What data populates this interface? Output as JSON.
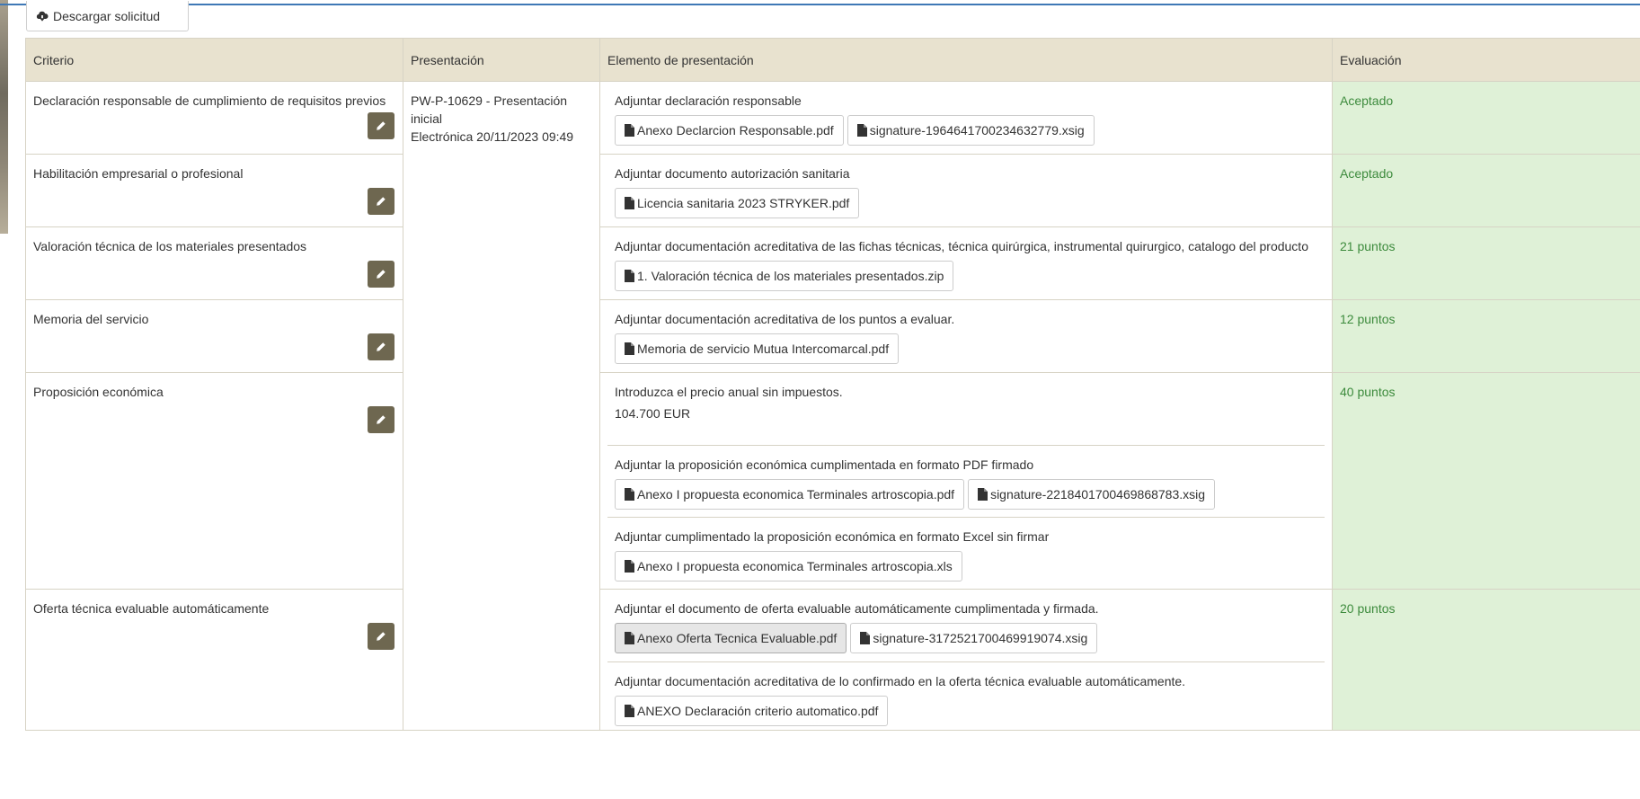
{
  "toolbar": {
    "download_label": "Descargar solicitud"
  },
  "table": {
    "headers": {
      "criterio": "Criterio",
      "presentacion": "Presentación",
      "elemento": "Elemento de presentación",
      "evaluacion": "Evaluación"
    },
    "presentacion": {
      "line1": "PW-P-10629 - Presentación inicial",
      "line2": "Electrónica 20/11/2023 09:49"
    },
    "rows": [
      {
        "criterio": "Declaración responsable de cumplimiento de requisitos previos",
        "evaluacion": "Aceptado",
        "elementos": [
          {
            "label": "Adjuntar declaración responsable",
            "files": [
              "Anexo Declarcion Responsable.pdf",
              "signature-1964641700234632779.xsig"
            ]
          }
        ]
      },
      {
        "criterio": "Habilitación empresarial o profesional",
        "evaluacion": "Aceptado",
        "elementos": [
          {
            "label": "Adjuntar documento autorización sanitaria",
            "files": [
              "Licencia sanitaria 2023 STRYKER.pdf"
            ]
          }
        ]
      },
      {
        "criterio": "Valoración técnica de los materiales presentados",
        "evaluacion": "21 puntos",
        "elementos": [
          {
            "label": "Adjuntar documentación acreditativa de las fichas técnicas, técnica quirúrgica, instrumental quirurgico, catalogo del producto",
            "files": [
              "1. Valoración técnica de los materiales presentados.zip"
            ]
          }
        ]
      },
      {
        "criterio": "Memoria del servicio",
        "evaluacion": "12 puntos",
        "elementos": [
          {
            "label": "Adjuntar documentación acreditativa de los puntos a evaluar.",
            "files": [
              "Memoria de servicio Mutua Intercomarcal.pdf"
            ]
          }
        ]
      },
      {
        "criterio": "Proposición económica",
        "evaluacion": "40 puntos",
        "elementos": [
          {
            "label": "Introduzca el precio anual sin impuestos.",
            "value": "104.700 EUR"
          },
          {
            "label": "Adjuntar la proposición económica cumplimentada en formato PDF firmado",
            "files": [
              "Anexo I propuesta economica Terminales artroscopia.pdf",
              "signature-2218401700469868783.xsig"
            ]
          },
          {
            "label": "Adjuntar cumplimentado la proposición económica en formato Excel sin firmar",
            "files": [
              "Anexo I propuesta economica Terminales artroscopia.xls"
            ]
          }
        ]
      },
      {
        "criterio": "Oferta técnica evaluable automáticamente",
        "evaluacion": "20 puntos",
        "elementos": [
          {
            "label": "Adjuntar el documento de oferta evaluable automáticamente cumplimentada y firmada.",
            "files": [
              "Anexo Oferta Tecnica Evaluable.pdf",
              "signature-3172521700469919074.xsig"
            ]
          },
          {
            "label": "Adjuntar documentación acreditativa de lo confirmado en la oferta técnica evaluable automáticamente.",
            "files": [
              "ANEXO Declaración criterio automatico.pdf"
            ]
          }
        ]
      }
    ]
  },
  "icons": {
    "download": "cloud-download-icon",
    "file": "file-icon",
    "edit": "pencil-icon"
  },
  "colors": {
    "header_bg": "#e8e2cf",
    "eval_bg": "#dff1d7",
    "eval_text": "#3d8b3d",
    "edit_button": "#6e6750",
    "top_line": "#3f78b6"
  }
}
